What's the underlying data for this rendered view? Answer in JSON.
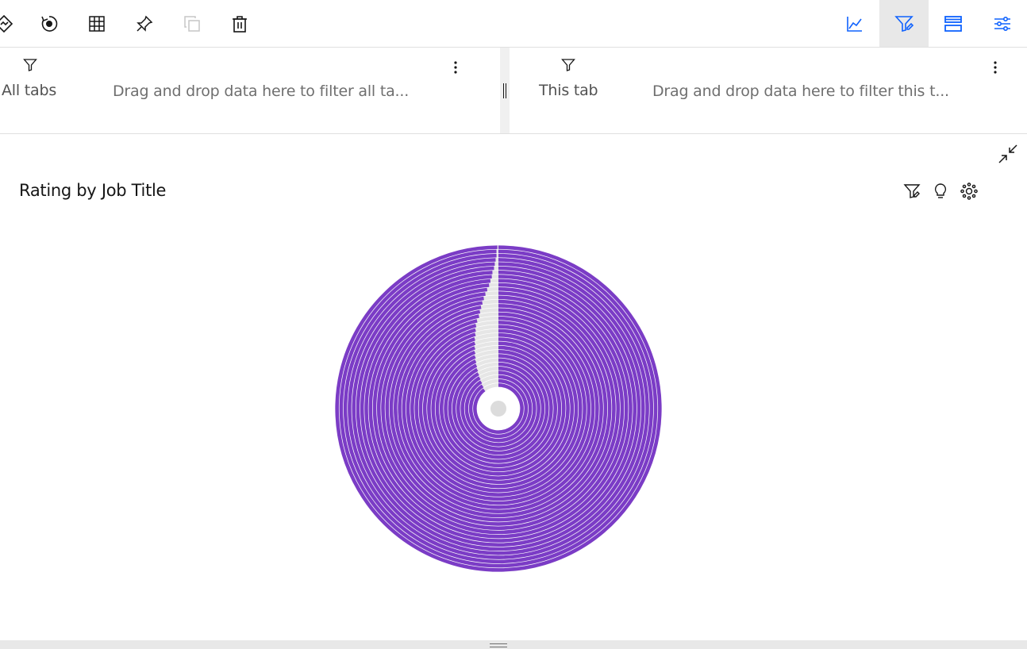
{
  "toolbar": {
    "left_icons": [
      "explain-icon",
      "undo-icon",
      "table-icon",
      "pin-icon",
      "duplicate-icon",
      "delete-icon"
    ],
    "right_icons": [
      "visualization-icon",
      "filters-icon",
      "fields-icon",
      "properties-icon"
    ],
    "active_right_icon": "filters-icon",
    "accent_color": "#0f62fe"
  },
  "filters": {
    "all_tabs": {
      "label": "All tabs",
      "drop_text": "Drag and drop data here to filter all ta..."
    },
    "this_tab": {
      "label": "This tab",
      "drop_text": "Drag and drop data here to filter this t..."
    }
  },
  "widget": {
    "title": "Rating by Job Title",
    "tool_icons": [
      "filter-icon",
      "insights-bulb-icon",
      "settings-icon"
    ]
  },
  "chart_data": {
    "type": "radial-bar",
    "title": "Rating by Job Title",
    "series_color": "#7b3cc6",
    "track_color": "#e6e6e6",
    "ring_count": 34,
    "values_fraction_of_circle": [
      0.999,
      0.998,
      0.998,
      0.997,
      0.996,
      0.995,
      0.993,
      0.992,
      0.99,
      0.988,
      0.985,
      0.982,
      0.979,
      0.976,
      0.973,
      0.97,
      0.967,
      0.962,
      0.958,
      0.955,
      0.952,
      0.948,
      0.945,
      0.941,
      0.937,
      0.933,
      0.929,
      0.925,
      0.921,
      0.917,
      0.913,
      0.909,
      0.903,
      0.897
    ]
  },
  "bottom_bar": {
    "handle_icon": "resize-handle-icon"
  }
}
